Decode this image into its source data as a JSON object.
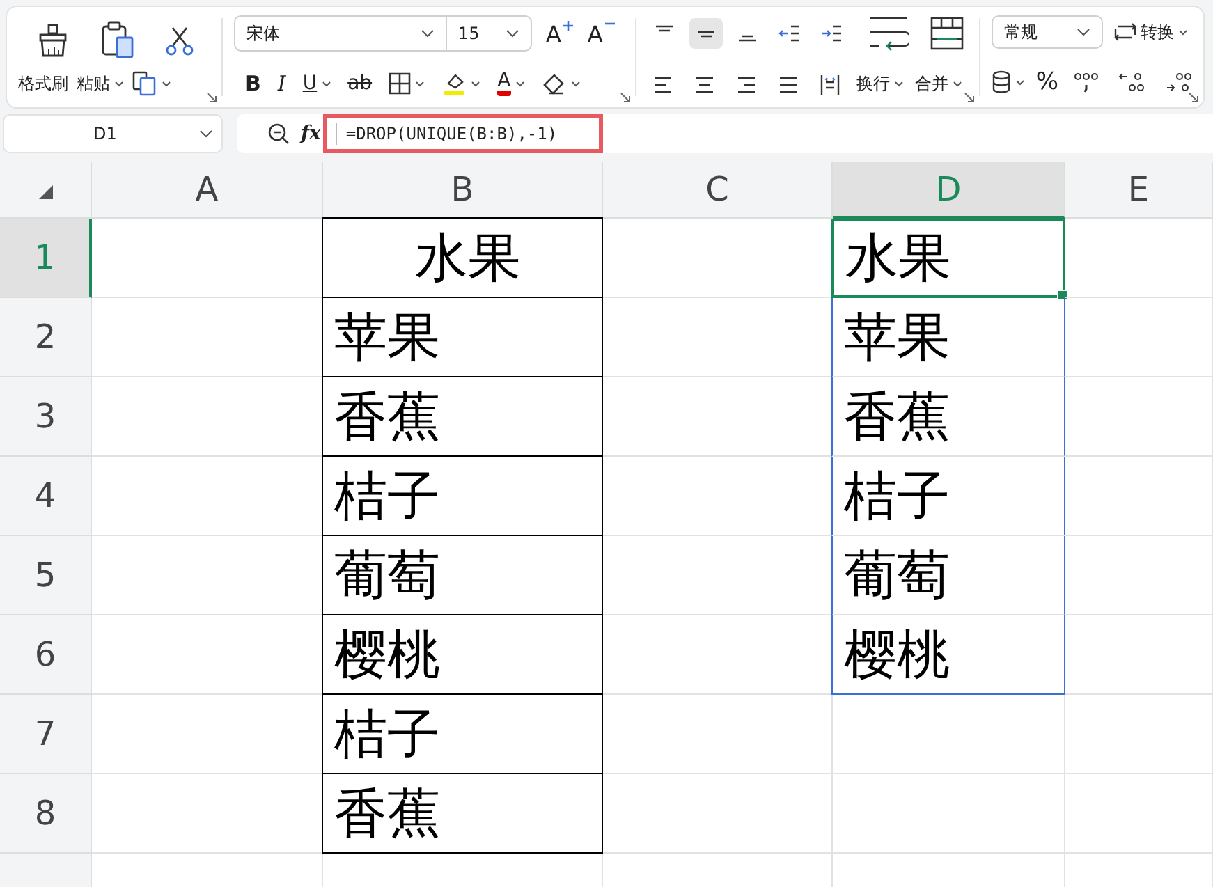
{
  "ribbon": {
    "clipboard": {
      "format_painter": "格式刷",
      "paste": "粘贴"
    },
    "font": {
      "name": "宋体",
      "size": "15",
      "grow": "A",
      "shrink": "A",
      "bold": "B",
      "italic": "I",
      "underline": "U",
      "strike": "ab",
      "font_color": "A"
    },
    "align_buttons": [
      {
        "selected": false
      },
      {
        "selected": true
      },
      {
        "selected": false
      },
      {
        "selected": false
      },
      {
        "selected": false
      }
    ],
    "alignment": {
      "wrap": "换行",
      "merge": "合并"
    },
    "number": {
      "format": "常规",
      "convert": "转换",
      "percent": "%"
    }
  },
  "formula_bar": {
    "name_box": "D1",
    "fx": "fx",
    "formula": "=DROP(UNIQUE(B:B),-1)",
    "highlighted": true
  },
  "columns": [
    {
      "label": "A",
      "selected": false
    },
    {
      "label": "B",
      "selected": false
    },
    {
      "label": "C",
      "selected": false
    },
    {
      "label": "D",
      "selected": true
    },
    {
      "label": "E",
      "selected": false
    }
  ],
  "rows": [
    {
      "label": "1",
      "selected": true,
      "kind": "header",
      "B": "水果",
      "D": "水果",
      "bordered": true,
      "in_selection": true,
      "active": true
    },
    {
      "label": "2",
      "selected": false,
      "kind": "item",
      "B": "苹果",
      "D": "苹果",
      "bordered": true,
      "in_selection": true,
      "active": false
    },
    {
      "label": "3",
      "selected": false,
      "kind": "item",
      "B": "香蕉",
      "D": "香蕉",
      "bordered": true,
      "in_selection": true,
      "active": false
    },
    {
      "label": "4",
      "selected": false,
      "kind": "item",
      "B": "桔子",
      "D": "桔子",
      "bordered": true,
      "in_selection": true,
      "active": false
    },
    {
      "label": "5",
      "selected": false,
      "kind": "item",
      "B": "葡萄",
      "D": "葡萄",
      "bordered": true,
      "in_selection": true,
      "active": false
    },
    {
      "label": "6",
      "selected": false,
      "kind": "item",
      "B": "樱桃",
      "D": "樱桃",
      "bordered": true,
      "in_selection": true,
      "active": false
    },
    {
      "label": "7",
      "selected": false,
      "kind": "item",
      "B": "桔子",
      "bordered": true,
      "in_selection": false,
      "active": false
    },
    {
      "label": "8",
      "selected": false,
      "kind": "item",
      "B": "香蕉",
      "bordered": true,
      "in_selection": false,
      "active": false
    }
  ]
}
